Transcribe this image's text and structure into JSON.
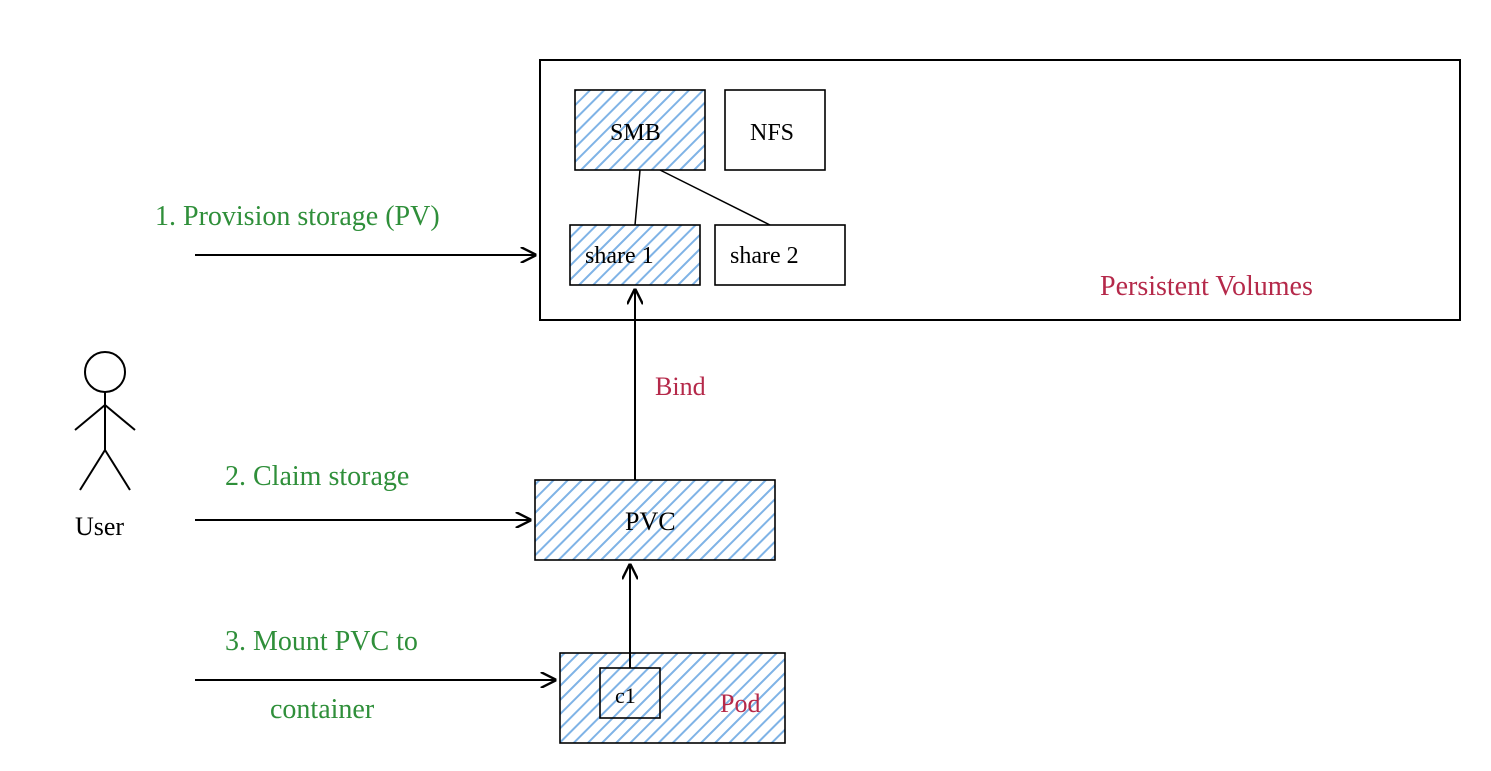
{
  "actor": {
    "label": "User"
  },
  "steps": {
    "s1": "1. Provision storage (PV)",
    "s2": "2. Claim storage",
    "s3": "3. Mount PVC to container"
  },
  "pv_container": {
    "label": "Persistent Volumes"
  },
  "boxes": {
    "smb": "SMB",
    "nfs": "NFS",
    "share1": "share 1",
    "share2": "share 2",
    "pvc": "PVC",
    "pod": "Pod",
    "c1": "c1"
  },
  "edges": {
    "bind": "Bind"
  },
  "colors": {
    "green": "#2f8f3a",
    "red": "#b5294a",
    "blue": "#7fb3e6",
    "stroke": "#000000"
  }
}
